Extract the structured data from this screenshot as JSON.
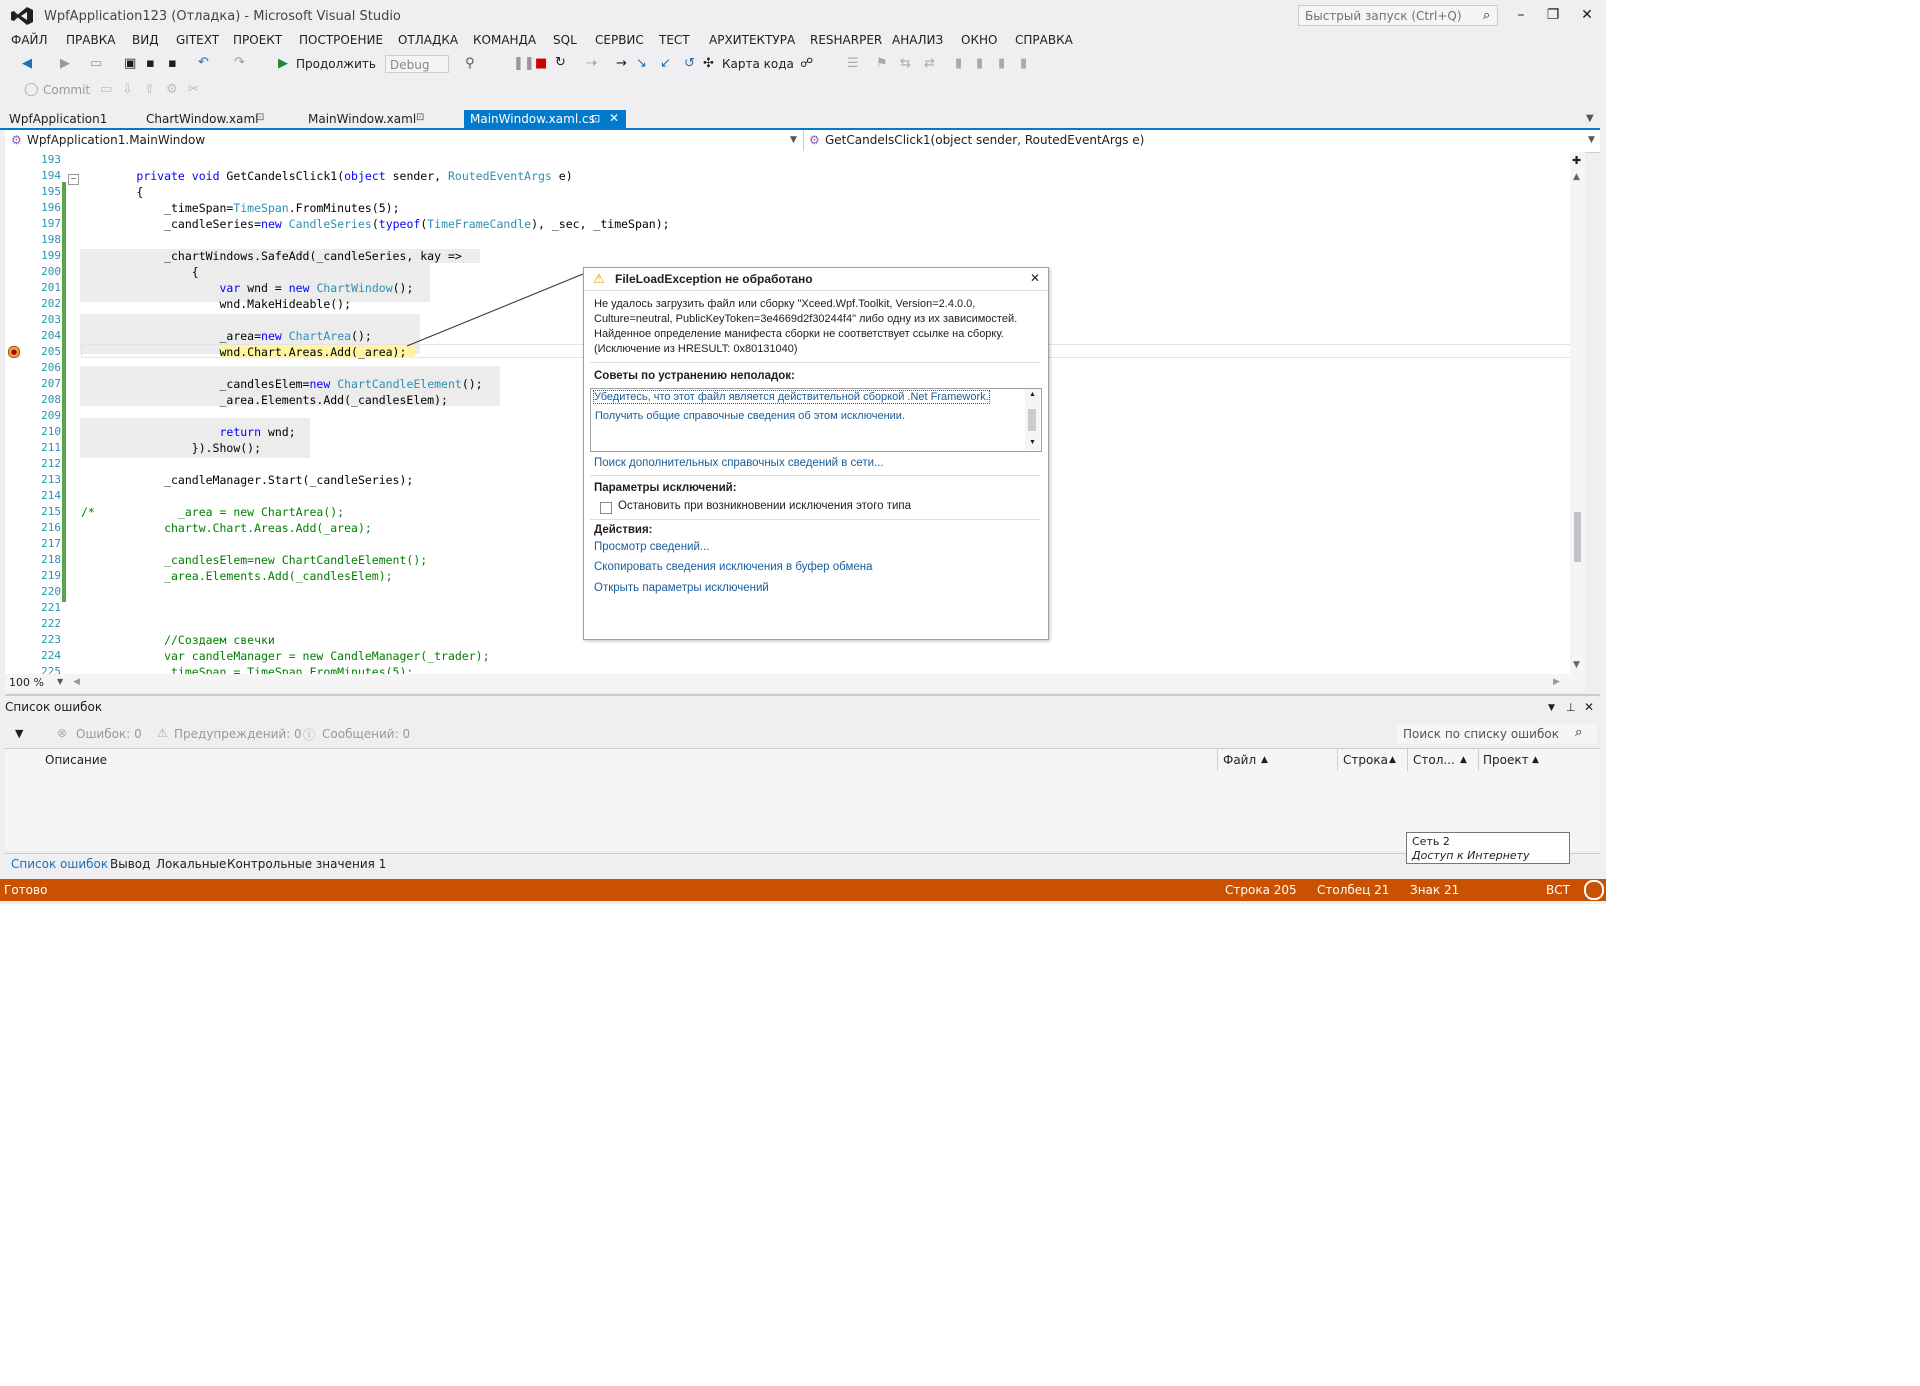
{
  "window": {
    "title": "WpfApplication123 (Отладка) - Microsoft Visual Studio",
    "quick_launch_placeholder": "Быстрый запуск (Ctrl+Q)"
  },
  "menu": [
    "ФАЙЛ",
    "ПРАВКА",
    "ВИД",
    "GITEXT",
    "ПРОЕКТ",
    "ПОСТРОЕНИЕ",
    "ОТЛАДКА",
    "КОМАНДА",
    "SQL",
    "СЕРВИС",
    "ТЕСТ",
    "АРХИТЕКТУРА",
    "RESHARPER",
    "АНАЛИЗ",
    "ОКНО",
    "СПРАВКА"
  ],
  "toolbar": {
    "continue_label": "Продолжить",
    "config_value": "Debug",
    "code_map_label": "Карта кода",
    "commit_label": "Commit"
  },
  "tabs": [
    {
      "label": "WpfApplication1"
    },
    {
      "label": "ChartWindow.xaml"
    },
    {
      "label": "MainWindow.xaml"
    },
    {
      "label": "MainWindow.xaml.cs"
    }
  ],
  "nav": {
    "class": "WpfApplication1.MainWindow",
    "member": "GetCandelsClick1(object sender, RoutedEventArgs e)"
  },
  "zoom": "100 %",
  "code": {
    "line_numbers": [
      "193",
      "194",
      "195",
      "196",
      "197",
      "198",
      "199",
      "200",
      "201",
      "202",
      "203",
      "204",
      "205",
      "206",
      "207",
      "208",
      "209",
      "210",
      "211",
      "212",
      "213",
      "214",
      "215",
      "216",
      "217",
      "218",
      "219",
      "220",
      "221",
      "222",
      "223",
      "224",
      "225"
    ]
  },
  "exception": {
    "title": "FileLoadException не обработано",
    "message": "Не удалось загрузить файл или сборку \"Xceed.Wpf.Toolkit, Version=2.4.0.0, Culture=neutral, PublicKeyToken=3e4669d2f30244f4\" либо одну из их зависимостей. Найденное определение манифеста сборки не соответствует ссылке на сборку. (Исключение из HRESULT: 0x80131040)",
    "tips_heading": "Советы по устранению неполадок:",
    "tip1": "Убедитесь, что этот файл является действительной сборкой .Net Framework.",
    "tip2": "Получить общие справочные сведения об этом исключении.",
    "search_online": "Поиск дополнительных справочных сведений в сети...",
    "params_heading": "Параметры исключений:",
    "break_checkbox": "Остановить при возникновении исключения этого типа",
    "actions_heading": "Действия:",
    "action_view": "Просмотр сведений...",
    "action_copy": "Скопировать сведения исключения в буфер обмена",
    "action_open": "Открыть параметры исключений"
  },
  "error_list": {
    "title": "Список ошибок",
    "errors": "Ошибок: 0",
    "warnings": "Предупреждений: 0",
    "messages": "Сообщений: 0",
    "search_placeholder": "Поиск по списку ошибок",
    "columns": [
      "Описание",
      "Файл",
      "Строка",
      "Стол...",
      "Проект"
    ]
  },
  "bottom_tabs": [
    "Список ошибок",
    "Вывод",
    "Локальные",
    "Контрольные значения 1"
  ],
  "tooltip": {
    "line1": "Сеть  2",
    "line2": "Доступ к Интернету"
  },
  "status": {
    "ready": "Готово",
    "line": "Строка 205",
    "col": "Столбец 21",
    "char": "Знак 21",
    "mode": "ВСТ"
  }
}
